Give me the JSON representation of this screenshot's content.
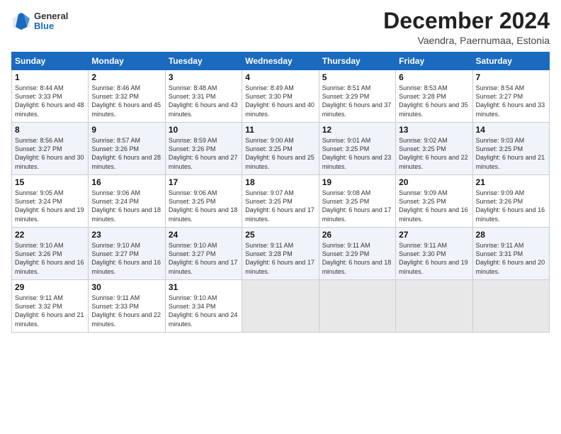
{
  "header": {
    "logo_general": "General",
    "logo_blue": "Blue",
    "month_title": "December 2024",
    "subtitle": "Vaendra, Paernumaa, Estonia"
  },
  "weekdays": [
    "Sunday",
    "Monday",
    "Tuesday",
    "Wednesday",
    "Thursday",
    "Friday",
    "Saturday"
  ],
  "weeks": [
    [
      {
        "day": "1",
        "sunrise": "Sunrise: 8:44 AM",
        "sunset": "Sunset: 3:33 PM",
        "daylight": "Daylight: 6 hours and 48 minutes."
      },
      {
        "day": "2",
        "sunrise": "Sunrise: 8:46 AM",
        "sunset": "Sunset: 3:32 PM",
        "daylight": "Daylight: 6 hours and 45 minutes."
      },
      {
        "day": "3",
        "sunrise": "Sunrise: 8:48 AM",
        "sunset": "Sunset: 3:31 PM",
        "daylight": "Daylight: 6 hours and 43 minutes."
      },
      {
        "day": "4",
        "sunrise": "Sunrise: 8:49 AM",
        "sunset": "Sunset: 3:30 PM",
        "daylight": "Daylight: 6 hours and 40 minutes."
      },
      {
        "day": "5",
        "sunrise": "Sunrise: 8:51 AM",
        "sunset": "Sunset: 3:29 PM",
        "daylight": "Daylight: 6 hours and 37 minutes."
      },
      {
        "day": "6",
        "sunrise": "Sunrise: 8:53 AM",
        "sunset": "Sunset: 3:28 PM",
        "daylight": "Daylight: 6 hours and 35 minutes."
      },
      {
        "day": "7",
        "sunrise": "Sunrise: 8:54 AM",
        "sunset": "Sunset: 3:27 PM",
        "daylight": "Daylight: 6 hours and 33 minutes."
      }
    ],
    [
      {
        "day": "8",
        "sunrise": "Sunrise: 8:56 AM",
        "sunset": "Sunset: 3:27 PM",
        "daylight": "Daylight: 6 hours and 30 minutes."
      },
      {
        "day": "9",
        "sunrise": "Sunrise: 8:57 AM",
        "sunset": "Sunset: 3:26 PM",
        "daylight": "Daylight: 6 hours and 28 minutes."
      },
      {
        "day": "10",
        "sunrise": "Sunrise: 8:59 AM",
        "sunset": "Sunset: 3:26 PM",
        "daylight": "Daylight: 6 hours and 27 minutes."
      },
      {
        "day": "11",
        "sunrise": "Sunrise: 9:00 AM",
        "sunset": "Sunset: 3:25 PM",
        "daylight": "Daylight: 6 hours and 25 minutes."
      },
      {
        "day": "12",
        "sunrise": "Sunrise: 9:01 AM",
        "sunset": "Sunset: 3:25 PM",
        "daylight": "Daylight: 6 hours and 23 minutes."
      },
      {
        "day": "13",
        "sunrise": "Sunrise: 9:02 AM",
        "sunset": "Sunset: 3:25 PM",
        "daylight": "Daylight: 6 hours and 22 minutes."
      },
      {
        "day": "14",
        "sunrise": "Sunrise: 9:03 AM",
        "sunset": "Sunset: 3:25 PM",
        "daylight": "Daylight: 6 hours and 21 minutes."
      }
    ],
    [
      {
        "day": "15",
        "sunrise": "Sunrise: 9:05 AM",
        "sunset": "Sunset: 3:24 PM",
        "daylight": "Daylight: 6 hours and 19 minutes."
      },
      {
        "day": "16",
        "sunrise": "Sunrise: 9:06 AM",
        "sunset": "Sunset: 3:24 PM",
        "daylight": "Daylight: 6 hours and 18 minutes."
      },
      {
        "day": "17",
        "sunrise": "Sunrise: 9:06 AM",
        "sunset": "Sunset: 3:25 PM",
        "daylight": "Daylight: 6 hours and 18 minutes."
      },
      {
        "day": "18",
        "sunrise": "Sunrise: 9:07 AM",
        "sunset": "Sunset: 3:25 PM",
        "daylight": "Daylight: 6 hours and 17 minutes."
      },
      {
        "day": "19",
        "sunrise": "Sunrise: 9:08 AM",
        "sunset": "Sunset: 3:25 PM",
        "daylight": "Daylight: 6 hours and 17 minutes."
      },
      {
        "day": "20",
        "sunrise": "Sunrise: 9:09 AM",
        "sunset": "Sunset: 3:25 PM",
        "daylight": "Daylight: 6 hours and 16 minutes."
      },
      {
        "day": "21",
        "sunrise": "Sunrise: 9:09 AM",
        "sunset": "Sunset: 3:26 PM",
        "daylight": "Daylight: 6 hours and 16 minutes."
      }
    ],
    [
      {
        "day": "22",
        "sunrise": "Sunrise: 9:10 AM",
        "sunset": "Sunset: 3:26 PM",
        "daylight": "Daylight: 6 hours and 16 minutes."
      },
      {
        "day": "23",
        "sunrise": "Sunrise: 9:10 AM",
        "sunset": "Sunset: 3:27 PM",
        "daylight": "Daylight: 6 hours and 16 minutes."
      },
      {
        "day": "24",
        "sunrise": "Sunrise: 9:10 AM",
        "sunset": "Sunset: 3:27 PM",
        "daylight": "Daylight: 6 hours and 17 minutes."
      },
      {
        "day": "25",
        "sunrise": "Sunrise: 9:11 AM",
        "sunset": "Sunset: 3:28 PM",
        "daylight": "Daylight: 6 hours and 17 minutes."
      },
      {
        "day": "26",
        "sunrise": "Sunrise: 9:11 AM",
        "sunset": "Sunset: 3:29 PM",
        "daylight": "Daylight: 6 hours and 18 minutes."
      },
      {
        "day": "27",
        "sunrise": "Sunrise: 9:11 AM",
        "sunset": "Sunset: 3:30 PM",
        "daylight": "Daylight: 6 hours and 19 minutes."
      },
      {
        "day": "28",
        "sunrise": "Sunrise: 9:11 AM",
        "sunset": "Sunset: 3:31 PM",
        "daylight": "Daylight: 6 hours and 20 minutes."
      }
    ],
    [
      {
        "day": "29",
        "sunrise": "Sunrise: 9:11 AM",
        "sunset": "Sunset: 3:32 PM",
        "daylight": "Daylight: 6 hours and 21 minutes."
      },
      {
        "day": "30",
        "sunrise": "Sunrise: 9:11 AM",
        "sunset": "Sunset: 3:33 PM",
        "daylight": "Daylight: 6 hours and 22 minutes."
      },
      {
        "day": "31",
        "sunrise": "Sunrise: 9:10 AM",
        "sunset": "Sunset: 3:34 PM",
        "daylight": "Daylight: 6 hours and 24 minutes."
      },
      null,
      null,
      null,
      null
    ]
  ]
}
